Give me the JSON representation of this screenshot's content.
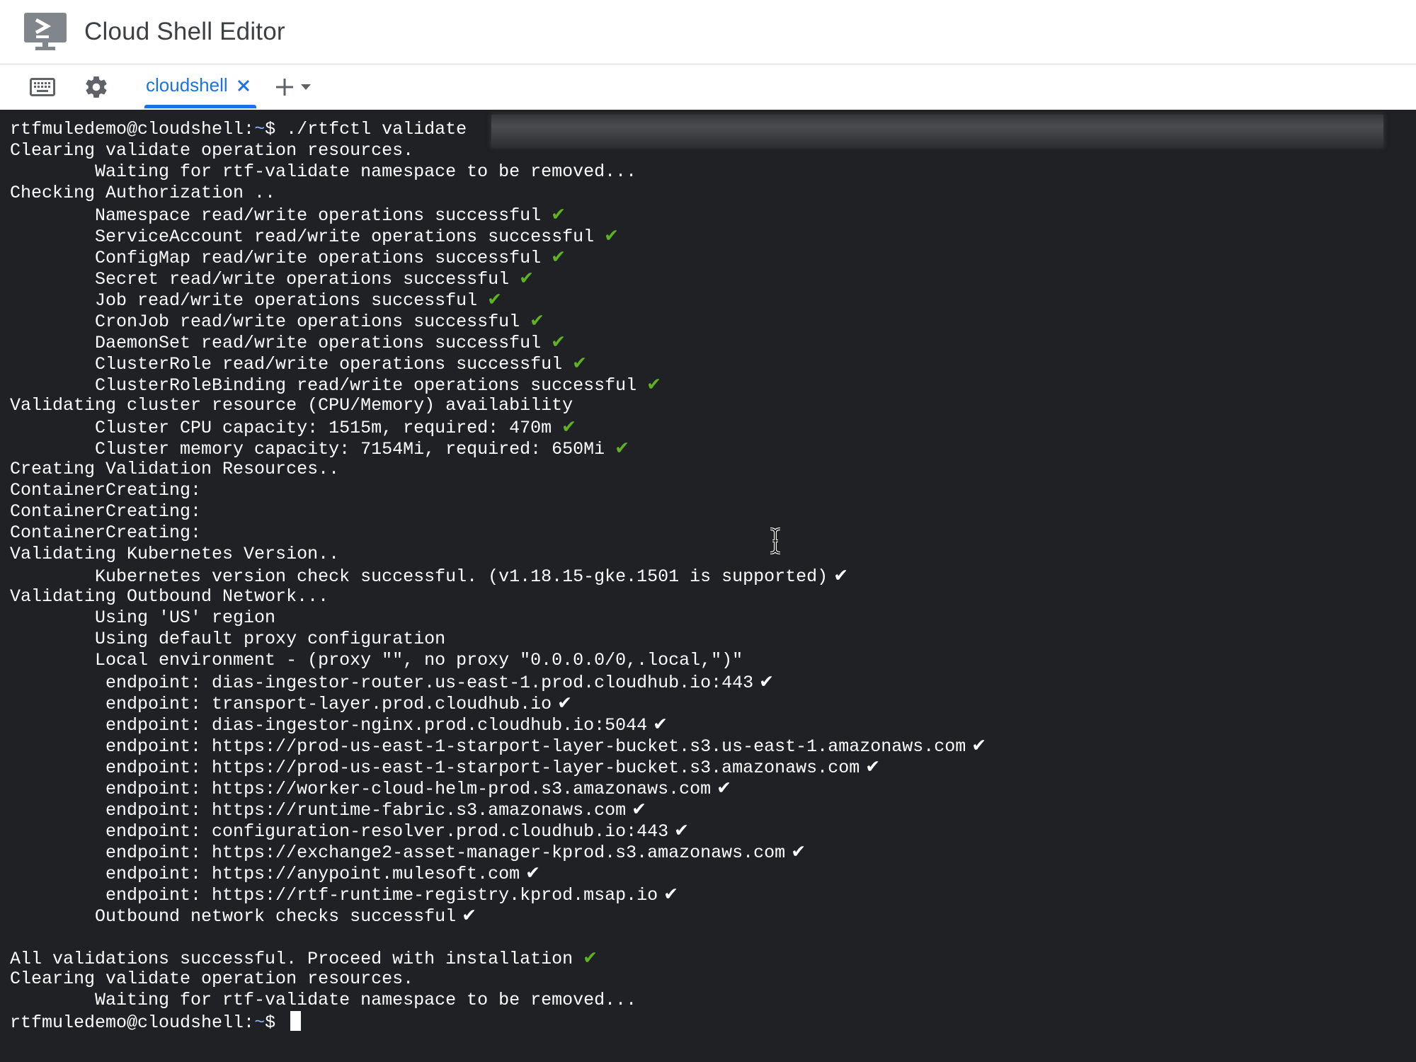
{
  "app": {
    "title": "Cloud Shell Editor",
    "logo_icon": "cloud-shell-terminal-icon"
  },
  "tabbar": {
    "keyboard_icon": "keyboard-icon",
    "settings_icon": "gear-icon",
    "active_tab_label": "cloudshell",
    "close_icon": "close-icon",
    "add_icon": "plus-icon",
    "dropdown_icon": "caret-down-icon",
    "accent_color": "#1a73e8"
  },
  "terminal": {
    "prompt_user_host": "rtfmuledemo@cloudshell:",
    "prompt_path": "~",
    "prompt_symbol": "$ ",
    "first_command": "./rtfctl validate ",
    "colors": {
      "background": "#202124",
      "text": "#ffffff",
      "path": "#8ab4f8",
      "check_green": "#5fb320"
    },
    "check_glyph": "✔",
    "lines": [
      {
        "text": "Clearing validate operation resources."
      },
      {
        "text": "        Waiting for rtf-validate namespace to be removed..."
      },
      {
        "text": "Checking Authorization .."
      },
      {
        "text": "        Namespace read/write operations successful",
        "check": "green"
      },
      {
        "text": "        ServiceAccount read/write operations successful",
        "check": "green"
      },
      {
        "text": "        ConfigMap read/write operations successful",
        "check": "green"
      },
      {
        "text": "        Secret read/write operations successful",
        "check": "green"
      },
      {
        "text": "        Job read/write operations successful",
        "check": "green"
      },
      {
        "text": "        CronJob read/write operations successful",
        "check": "green"
      },
      {
        "text": "        DaemonSet read/write operations successful",
        "check": "green"
      },
      {
        "text": "        ClusterRole read/write operations successful",
        "check": "green"
      },
      {
        "text": "        ClusterRoleBinding read/write operations successful",
        "check": "green"
      },
      {
        "text": "Validating cluster resource (CPU/Memory) availability"
      },
      {
        "text": "        Cluster CPU capacity: 1515m, required: 470m",
        "check": "green"
      },
      {
        "text": "        Cluster memory capacity: 7154Mi, required: 650Mi",
        "check": "green"
      },
      {
        "text": "Creating Validation Resources.."
      },
      {
        "text": "ContainerCreating:"
      },
      {
        "text": "ContainerCreating:"
      },
      {
        "text": "ContainerCreating:"
      },
      {
        "text": "Validating Kubernetes Version.."
      },
      {
        "text": "        Kubernetes version check successful. (v1.18.15-gke.1501 is supported)",
        "check": "white"
      },
      {
        "text": "Validating Outbound Network..."
      },
      {
        "text": "        Using 'US' region"
      },
      {
        "text": "        Using default proxy configuration"
      },
      {
        "text": "        Local environment - (proxy \"\", no proxy \"0.0.0.0/0,.local,\")\""
      },
      {
        "text": "         endpoint: dias-ingestor-router.us-east-1.prod.cloudhub.io:443",
        "check": "white"
      },
      {
        "text": "         endpoint: transport-layer.prod.cloudhub.io",
        "check": "white"
      },
      {
        "text": "         endpoint: dias-ingestor-nginx.prod.cloudhub.io:5044",
        "check": "white"
      },
      {
        "text": "         endpoint: https://prod-us-east-1-starport-layer-bucket.s3.us-east-1.amazonaws.com",
        "check": "white"
      },
      {
        "text": "         endpoint: https://prod-us-east-1-starport-layer-bucket.s3.amazonaws.com",
        "check": "white"
      },
      {
        "text": "         endpoint: https://worker-cloud-helm-prod.s3.amazonaws.com",
        "check": "white"
      },
      {
        "text": "         endpoint: https://runtime-fabric.s3.amazonaws.com",
        "check": "white"
      },
      {
        "text": "         endpoint: configuration-resolver.prod.cloudhub.io:443",
        "check": "white"
      },
      {
        "text": "         endpoint: https://exchange2-asset-manager-kprod.s3.amazonaws.com",
        "check": "white"
      },
      {
        "text": "         endpoint: https://anypoint.mulesoft.com",
        "check": "white"
      },
      {
        "text": "         endpoint: https://rtf-runtime-registry.kprod.msap.io",
        "check": "white"
      },
      {
        "text": "        Outbound network checks successful",
        "check": "white"
      },
      {
        "text": ""
      },
      {
        "text": "All validations successful. Proceed with installation",
        "check": "green"
      },
      {
        "text": "Clearing validate operation resources."
      },
      {
        "text": "        Waiting for rtf-validate namespace to be removed..."
      }
    ]
  }
}
